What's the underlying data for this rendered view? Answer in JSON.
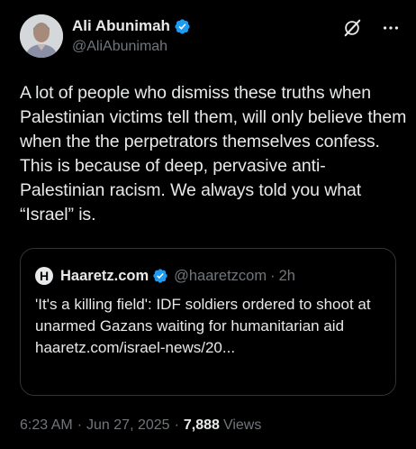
{
  "author": {
    "name": "Ali Abunimah",
    "handle": "@AliAbunimah"
  },
  "tweet": {
    "text": "A lot of people who dismiss these truths when Palestinian victims tell them, will only believe them when the the perpetrators themselves confess. This is because of deep, pervasive anti-Palestinian racism. We always told you what “Israel” is."
  },
  "quote": {
    "logo_letter": "H",
    "name": "Haaretz.com",
    "handle": "@haaretzcom",
    "separator": "·",
    "time": "2h",
    "text": "'It's a killing field': IDF soldiers ordered to shoot at unarmed Gazans waiting for humanitarian aid\nhaaretz.com/israel-news/20..."
  },
  "footer": {
    "time": "6:23 AM",
    "sep1": "·",
    "date": "Jun 27, 2025",
    "sep2": "·",
    "views_count": "7,888",
    "views_label": "Views"
  },
  "icons": {
    "verified": "verified-badge-icon",
    "grok": "grok-icon",
    "more": "more-icon"
  },
  "colors": {
    "background": "#000000",
    "text": "#e7e9ea",
    "muted": "#71767b",
    "verified": "#1d9bf0",
    "border": "#2f3336"
  }
}
